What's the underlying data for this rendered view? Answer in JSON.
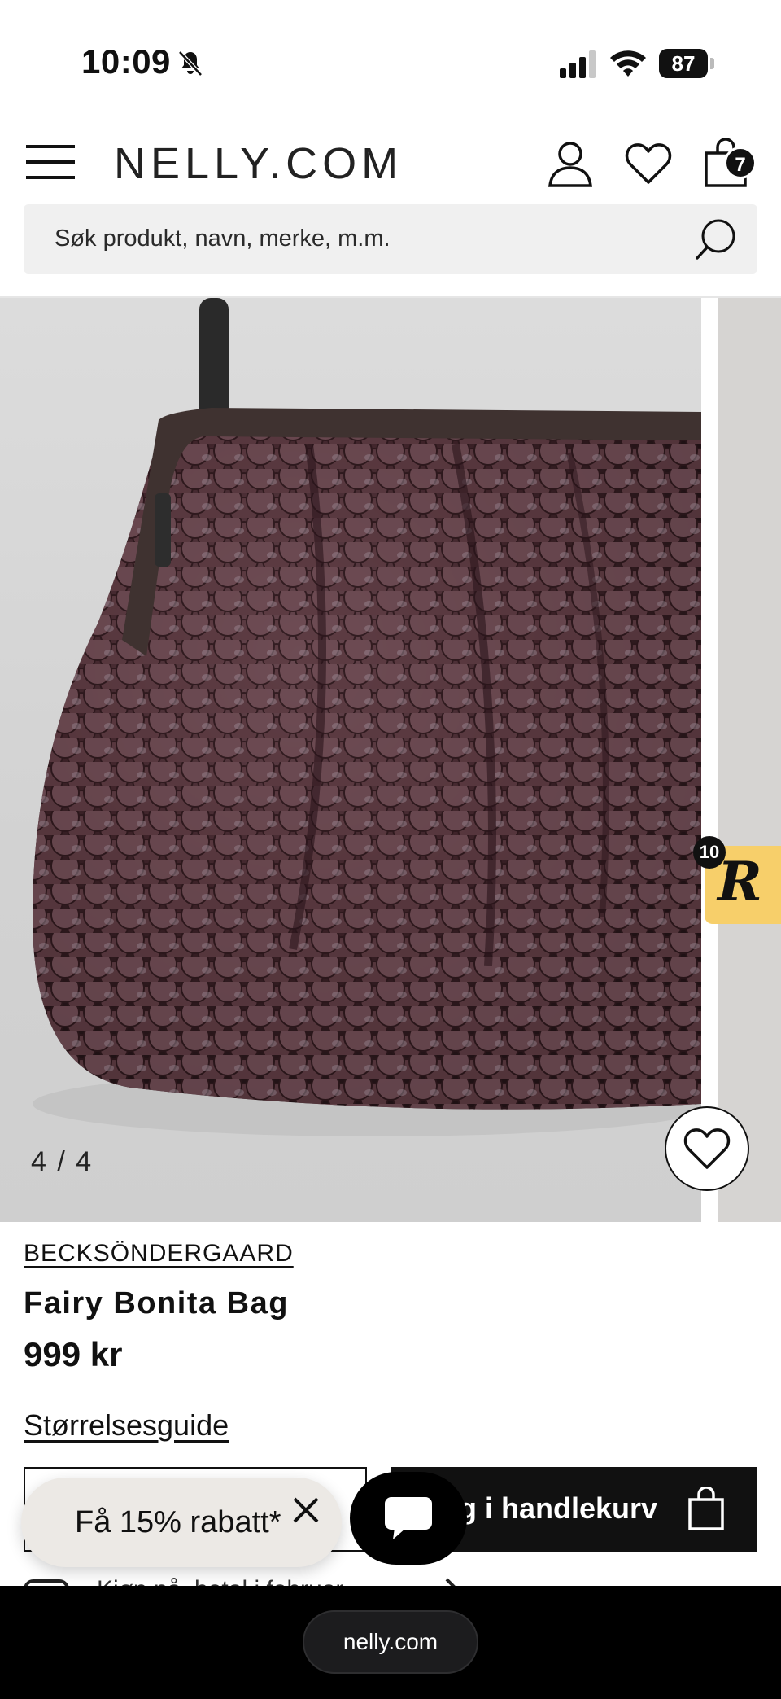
{
  "status_bar": {
    "time": "10:09",
    "battery": "87",
    "icons": [
      "bell-slash-icon",
      "cellular-signal-icon",
      "wifi-icon",
      "battery-icon"
    ]
  },
  "header": {
    "logo": "NELLY.COM",
    "cart_count": "7",
    "icons": [
      "hamburger-menu-icon",
      "account-icon",
      "heart-icon",
      "shopping-bag-icon"
    ]
  },
  "search": {
    "placeholder": "Søk produkt, navn, merke, m.m."
  },
  "gallery": {
    "pager": "4 / 4",
    "reviews_count": "10",
    "reviews_letter": "R"
  },
  "product": {
    "brand": "BECKSÖNDERGAARD",
    "name": "Fairy Bonita Bag",
    "price": "999 kr",
    "size_guide": "Størrelsesguide",
    "add_to_cart": "Legg i handlekurv",
    "hotel_text": "Kjøp nå, betal i februar"
  },
  "promo": {
    "text": "Få 15% rabatt*"
  },
  "browser": {
    "url": "nelly.com"
  },
  "colors": {
    "review_tab": "#f7cf6a",
    "dark": "#111111",
    "search_bg": "#f0f0f0"
  }
}
